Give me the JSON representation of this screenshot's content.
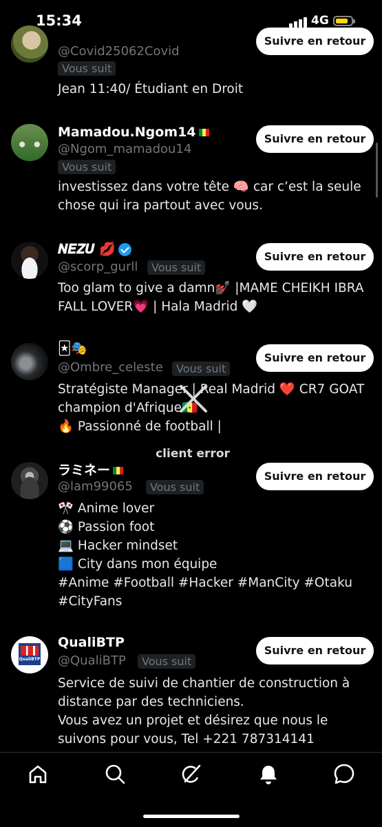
{
  "status": {
    "time": "15:34",
    "network": "4G"
  },
  "users": [
    {
      "name": "",
      "handle": "@Covid25062Covid",
      "badge": "Vous suit",
      "bio": [
        "Jean 11:40/ Étudiant en Droit"
      ],
      "button": "Suivre en retour"
    },
    {
      "name": "Mamadou.Ngom14",
      "handle": "@Ngom_mamadou14",
      "badge": "Vous suit",
      "bio": [
        "investissez dans votre tête 🧠 car c’est la seule",
        "chose qui ira partout avec vous."
      ],
      "button": "Suivre en retour"
    },
    {
      "name": "𝑵𝑬𝒁𝑼 💋",
      "handle": "@scorp_gurll",
      "badge": "Vous suit",
      "bio": [
        "Too glam to give a damn💅🏿 |MAME CHEIKH IBRA",
        "FALL LOVER💗 | Hala Madrid 🤍"
      ],
      "button": "Suivre en retour"
    },
    {
      "name": "🃏🎭",
      "handle": "@Ombre_celeste",
      "badge": "Vous suit",
      "bio": [
        "Stratégiste Manager | Real Madrid ❤️ CR7 GOAT",
        "champion d'Afrique🇸🇳",
        "🔥 Passionné de football |"
      ],
      "button": "Suivre en retour"
    },
    {
      "name": "ラミネー",
      "handle": "@lam99065",
      "badge": "Vous suit",
      "bio": [
        "🎌 Anime lover",
        "⚽ Passion foot",
        "💻 Hacker mindset",
        "🟦 City dans mon équipe",
        "#Anime #Football #Hacker #ManCity #Otaku",
        "#CityFans"
      ],
      "button": "Suivre en retour"
    },
    {
      "name": "QualiBTP",
      "handle": "@QualiBTP",
      "badge": "Vous suit",
      "bio": [
        "Service de suivi de chantier de construction à",
        "distance par des techniciens.",
        "Vous avez un projet et désirez que nous le",
        "suivons pour vous, Tel +221 787314141"
      ],
      "button": "Suivre en retour",
      "avatar_text": "QualiBTP"
    }
  ],
  "error": {
    "text": "client error"
  },
  "icons": [
    "home-icon",
    "search-icon",
    "grok-icon",
    "notifications-icon",
    "messages-icon"
  ]
}
